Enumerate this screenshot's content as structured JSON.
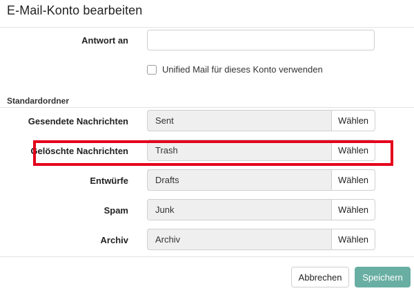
{
  "dialog": {
    "title": "E-Mail-Konto bearbeiten"
  },
  "reply_to": {
    "label": "Antwort an",
    "value": "",
    "placeholder": ""
  },
  "unified_mail": {
    "label": "Unified Mail für dieses Konto verwenden",
    "checked": false
  },
  "standard_folders": {
    "title": "Standardordner",
    "choose_label": "Wählen",
    "rows": [
      {
        "label": "Gesendete Nachrichten",
        "value": "Sent"
      },
      {
        "label": "Gelöschte Nachrichten",
        "value": "Trash"
      },
      {
        "label": "Entwürfe",
        "value": "Drafts"
      },
      {
        "label": "Spam",
        "value": "Junk"
      },
      {
        "label": "Archiv",
        "value": "Archiv"
      }
    ]
  },
  "footer": {
    "cancel_label": "Abbrechen",
    "save_label": "Speichern"
  },
  "colors": {
    "highlight": "#e4001b",
    "save_button": "#69aea3",
    "readonly_field": "#efefef"
  }
}
